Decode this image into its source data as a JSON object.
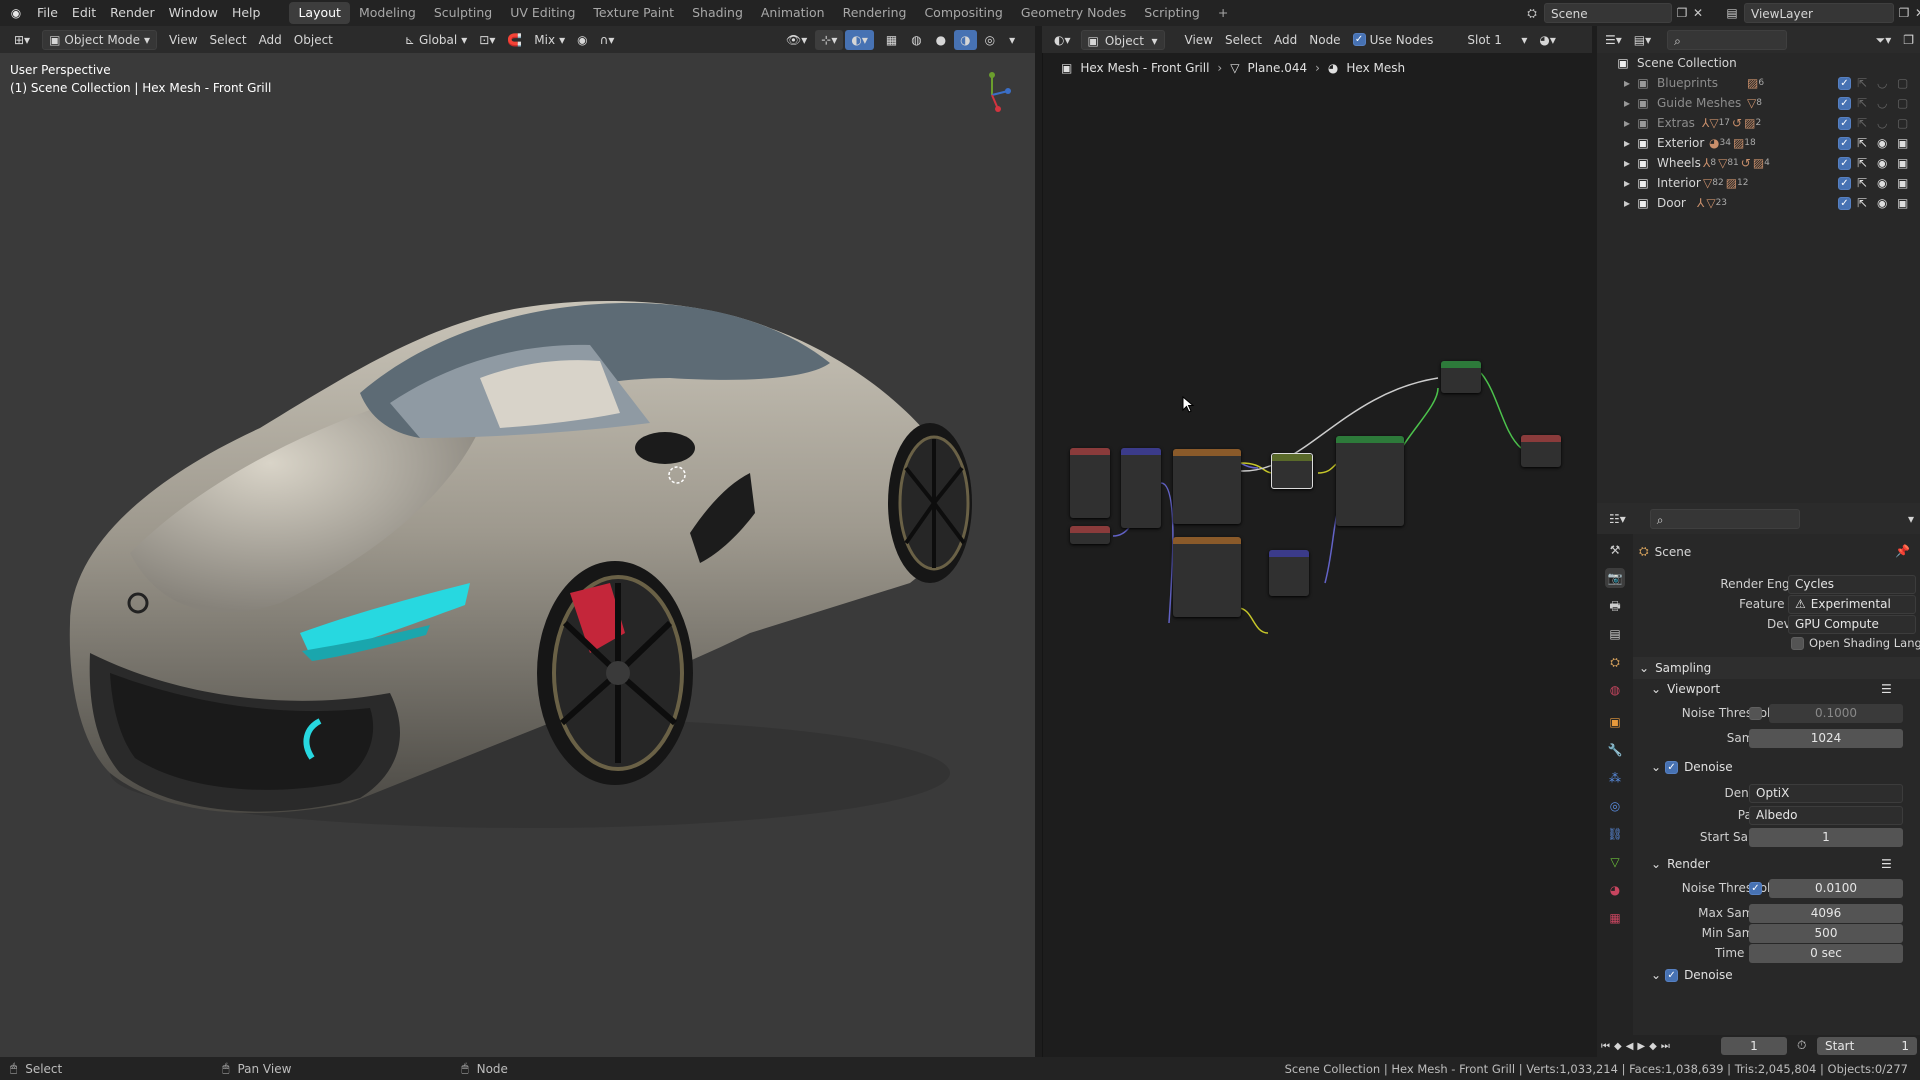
{
  "topbar": {
    "menus": [
      "File",
      "Edit",
      "Render",
      "Window",
      "Help"
    ],
    "workspaces": [
      "Layout",
      "Modeling",
      "Sculpting",
      "UV Editing",
      "Texture Paint",
      "Shading",
      "Animation",
      "Rendering",
      "Compositing",
      "Geometry Nodes",
      "Scripting"
    ],
    "active_workspace": "Layout",
    "add_tab": "+",
    "scene": "Scene",
    "view_layer": "ViewLayer"
  },
  "viewport": {
    "mode": "Object Mode",
    "menus": [
      "View",
      "Select",
      "Add",
      "Object"
    ],
    "orientation": "Global",
    "blend": "Mix",
    "overlay_title": "User Perspective",
    "overlay_subtitle": "(1) Scene Collection | Hex Mesh - Front Grill"
  },
  "node_editor": {
    "type": "Object",
    "menus": [
      "View",
      "Select",
      "Add",
      "Node"
    ],
    "use_nodes_label": "Use Nodes",
    "slot": "Slot 1",
    "breadcrumb": [
      "Hex Mesh - Front Grill",
      "Plane.044",
      "Hex Mesh"
    ]
  },
  "outliner": {
    "root": "Scene Collection",
    "collections": [
      {
        "name": "Blueprints",
        "count": "6",
        "enabled": true,
        "dim": true
      },
      {
        "name": "Guide Meshes",
        "count": "8",
        "enabled": true,
        "dim": true
      },
      {
        "name": "Extras",
        "count": "17",
        "count2": "2",
        "enabled": true,
        "dim": true
      },
      {
        "name": "Exterior",
        "count": "34",
        "count2": "18",
        "enabled": true,
        "dim": false
      },
      {
        "name": "Wheels",
        "count": "8",
        "count2": "81",
        "count3": "4",
        "enabled": true,
        "dim": false
      },
      {
        "name": "Interior",
        "count": "82",
        "count2": "12",
        "enabled": true,
        "dim": false
      },
      {
        "name": "Door",
        "count": "23",
        "enabled": true,
        "dim": false
      }
    ]
  },
  "properties": {
    "context": "Scene",
    "render_engine_label": "Render Engine",
    "render_engine": "Cycles",
    "feature_set_label": "Feature Set",
    "feature_set": "Experimental",
    "device_label": "Device",
    "device": "GPU Compute",
    "osl_label": "Open Shading Language",
    "sampling_label": "Sampling",
    "viewport_label": "Viewport",
    "noise_threshold_label": "Noise Threshold",
    "viewport_noise_threshold": "0.1000",
    "samples_label": "Samples",
    "viewport_samples": "1024",
    "denoise_label": "Denoise",
    "denoiser_label": "Denoiser",
    "denoiser": "OptiX",
    "passes_label": "Passes",
    "passes": "Albedo",
    "start_sample_label": "Start Sample",
    "start_sample": "1",
    "render_label": "Render",
    "render_noise_threshold": "0.0100",
    "max_samples_label": "Max Samples",
    "max_samples": "4096",
    "min_samples_label": "Min Samples",
    "min_samples": "500",
    "time_limit_label": "Time Limit",
    "time_limit": "0 sec",
    "denoise2_label": "Denoise"
  },
  "timeline": {
    "frame": "1",
    "start_label": "Start",
    "start": "1"
  },
  "statusbar": {
    "select": "Select",
    "pan": "Pan View",
    "node": "Node",
    "info": "Scene Collection | Hex Mesh - Front Grill | Verts:1,033,214 | Faces:1,038,639 | Tris:2,045,804 | Objects:0/277"
  },
  "colors": {
    "accent": "#4772b3",
    "active_workspace_bg": "#3d3d3d",
    "headlight": "#27d8e0",
    "caliper": "#c4263a"
  }
}
